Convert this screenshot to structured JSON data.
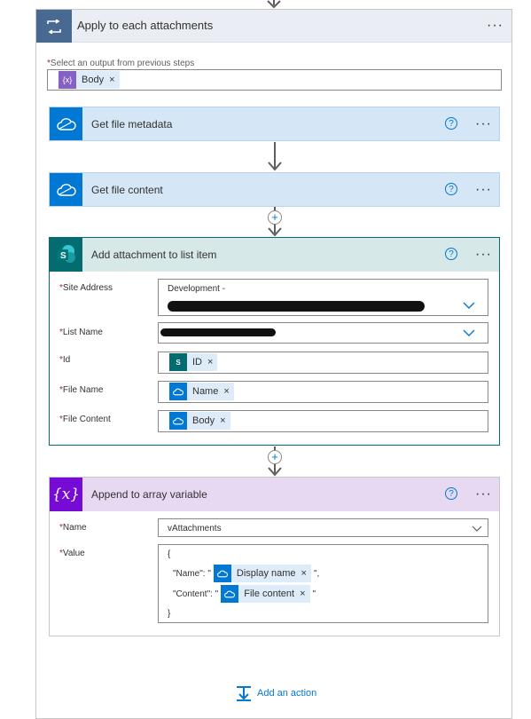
{
  "apply_each": {
    "title": "Apply to each attachments",
    "select_label": "Select an output from previous steps",
    "token": "Body"
  },
  "get_metadata": {
    "title": "Get file metadata"
  },
  "get_content": {
    "title": "Get file content"
  },
  "add_attachment": {
    "title": "Add attachment to list item",
    "site_address_label": "Site Address",
    "site_address_value": "Development -",
    "list_name_label": "List Name",
    "id_label": "Id",
    "id_token": "ID",
    "file_name_label": "File Name",
    "file_name_token": "Name",
    "file_content_label": "File Content",
    "file_content_token": "Body"
  },
  "append": {
    "title": "Append to array variable",
    "name_label": "Name",
    "name_value": "vAttachments",
    "value_label": "Value",
    "line_open": "{",
    "name_key": "\"Name\": \"",
    "name_token": "Display name",
    "name_tail": "\",",
    "content_key": "\"Content\": \"",
    "content_token": "File content",
    "content_tail": "\"",
    "line_close": "}"
  },
  "add_action": {
    "label": "Add an action"
  },
  "common": {
    "more": "···",
    "help": "?",
    "remove": "×",
    "plus": "+"
  },
  "colors": {
    "loop": "#486991",
    "onedrive": "#0078d4",
    "sharepoint": "#036c70",
    "variable": "#770bd6",
    "expression": "#8661c5"
  }
}
